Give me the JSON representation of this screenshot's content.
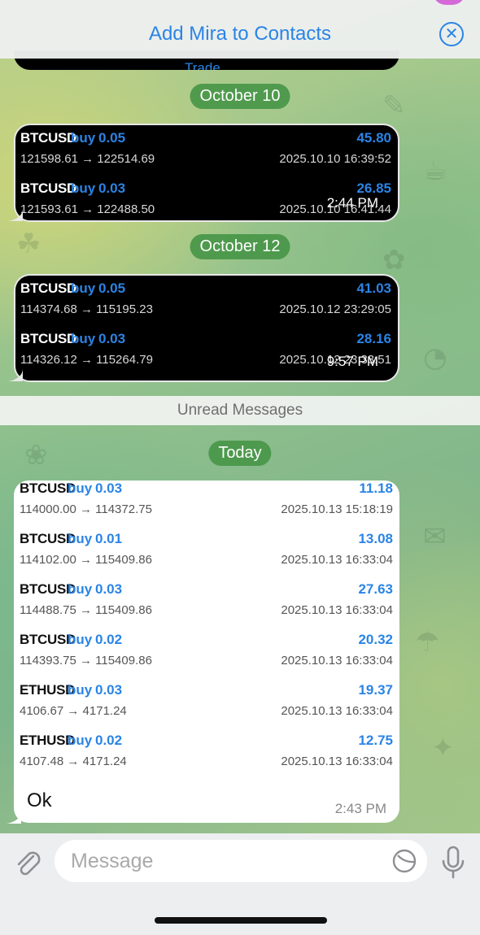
{
  "header": {
    "title": "Add Mira to Contacts"
  },
  "dates": {
    "first": "October 10",
    "second": "October 12",
    "today": "Today"
  },
  "cropped_label": "Trade",
  "dark_messages": [
    {
      "time": "2:44 PM",
      "trades": [
        {
          "symbol": "BTCUSD",
          "direction": "buy",
          "volume": "0.05",
          "profit": "45.80",
          "range": "121598.61 → 122514.69",
          "timestamp": "2025.10.10 16:39:52"
        },
        {
          "symbol": "BTCUSD",
          "direction": "buy",
          "volume": "0.03",
          "profit": "26.85",
          "range": "121593.61 → 122488.50",
          "timestamp": "2025.10.10 16:41:44"
        }
      ]
    },
    {
      "time": "9:57 PM",
      "trades": [
        {
          "symbol": "BTCUSD",
          "direction": "buy",
          "volume": "0.05",
          "profit": "41.03",
          "range": "114374.68 → 115195.23",
          "timestamp": "2025.10.12 23:29:05"
        },
        {
          "symbol": "BTCUSD",
          "direction": "buy",
          "volume": "0.03",
          "profit": "28.16",
          "range": "114326.12 → 115264.79",
          "timestamp": "2025.10.12 23:33:51"
        }
      ]
    }
  ],
  "unread_label": "Unread Messages",
  "light_message": {
    "trades": [
      {
        "symbol": "BTCUSD",
        "direction": "buy",
        "volume": "0.03",
        "profit": "11.18",
        "range": "114000.00 → 114372.75",
        "timestamp": "2025.10.13 15:18:19"
      },
      {
        "symbol": "BTCUSD",
        "direction": "buy",
        "volume": "0.01",
        "profit": "13.08",
        "range": "114102.00 → 115409.86",
        "timestamp": "2025.10.13 16:33:04"
      },
      {
        "symbol": "BTCUSD",
        "direction": "buy",
        "volume": "0.03",
        "profit": "27.63",
        "range": "114488.75 → 115409.86",
        "timestamp": "2025.10.13 16:33:04"
      },
      {
        "symbol": "BTCUSD",
        "direction": "buy",
        "volume": "0.02",
        "profit": "20.32",
        "range": "114393.75 → 115409.86",
        "timestamp": "2025.10.13 16:33:04"
      },
      {
        "symbol": "ETHUSD",
        "direction": "buy",
        "volume": "0.03",
        "profit": "19.37",
        "range": "4106.67 → 4171.24",
        "timestamp": "2025.10.13 16:33:04"
      },
      {
        "symbol": "ETHUSD",
        "direction": "buy",
        "volume": "0.02",
        "profit": "12.75",
        "range": "4107.48 → 4171.24",
        "timestamp": "2025.10.13 16:33:04"
      }
    ],
    "text": "Ok",
    "time": "2:43 PM"
  },
  "composer": {
    "placeholder": "Message"
  },
  "colors": {
    "accent": "#2a84e6",
    "date_pill": "#489648"
  },
  "icons": {
    "close": "close-circle-icon",
    "attach": "paperclip-icon",
    "sticker": "sticker-icon",
    "mic": "microphone-icon"
  }
}
